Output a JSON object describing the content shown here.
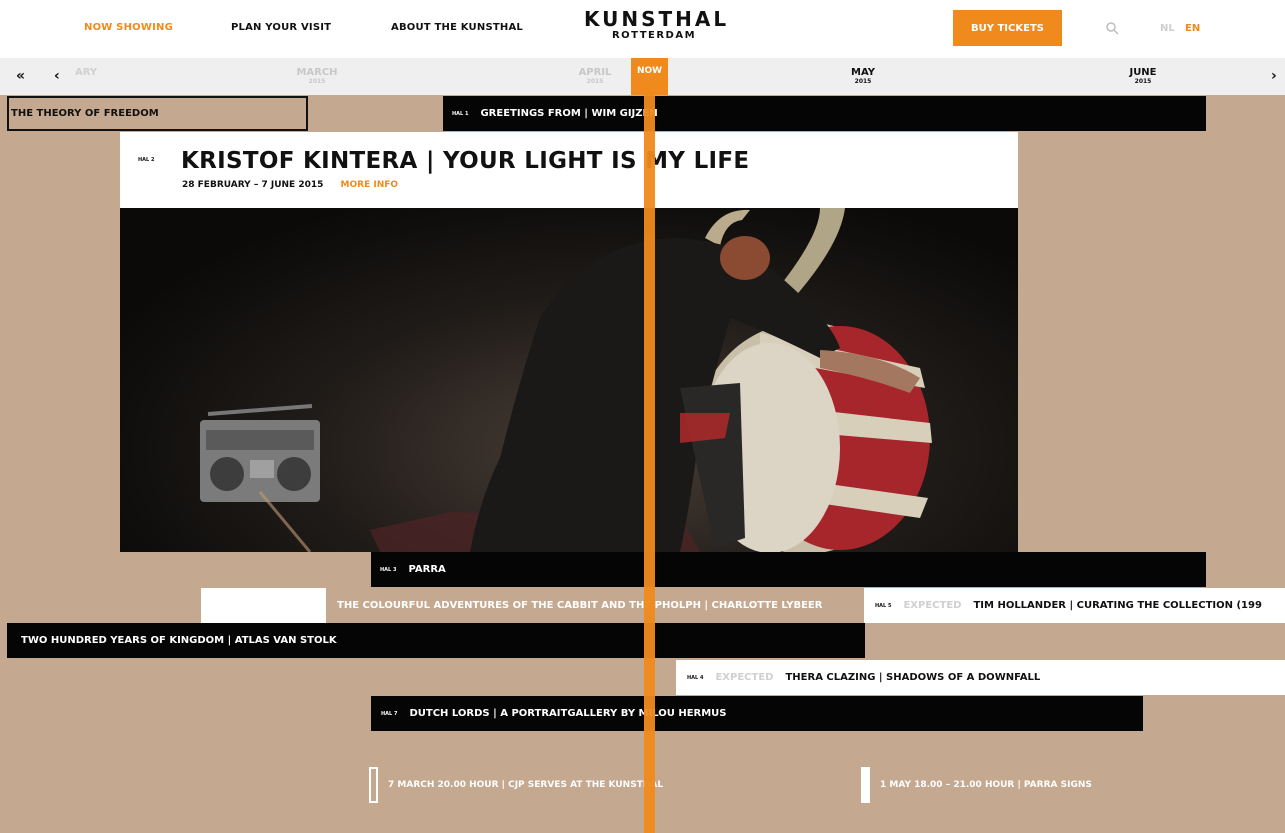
{
  "nav": {
    "now_showing": "NOW SHOWING",
    "plan_visit": "PLAN YOUR VISIT",
    "about": "ABOUT THE KUNSTHAL"
  },
  "logo": {
    "main": "KUNSTHAL",
    "sub": "ROTTERDAM"
  },
  "buy_tickets": "BUY TICKETS",
  "lang": {
    "nl": "NL",
    "en": "EN"
  },
  "timeline": {
    "partial_month": "ARY",
    "months": [
      {
        "name": "MARCH",
        "year": "2015"
      },
      {
        "name": "APRIL",
        "year": "2015"
      },
      {
        "name": "MAY",
        "year": "2015"
      },
      {
        "name": "JUNE",
        "year": "2015"
      }
    ],
    "now": "NOW"
  },
  "exhibitions": {
    "theory": {
      "title": "THE THEORY OF FREEDOM"
    },
    "greetings": {
      "hal": "HAL 1",
      "title": "GREETINGS FROM | WIM GIJZEN"
    },
    "parra": {
      "hal": "HAL 3",
      "title": "PARRA"
    },
    "cabbit": {
      "title": "THE COLOURFUL ADVENTURES OF THE CABBIT AND THE PHOLPH | CHARLOTTE LYBEER"
    },
    "tim": {
      "hal": "HAL 5",
      "expected": "EXPECTED",
      "title": "TIM HOLLANDER | CURATING THE COLLECTION (199"
    },
    "kingdom": {
      "title": "TWO HUNDRED YEARS OF KINGDOM | ATLAS VAN STOLK"
    },
    "thera": {
      "hal": "HAL 4",
      "expected": "EXPECTED",
      "title": "THERA CLAZING | SHADOWS OF A DOWNFALL"
    },
    "dutch": {
      "hal": "HAL 7",
      "title": "DUTCH LORDS | A PORTRAITGALLERY BY MILOU HERMUS"
    }
  },
  "feature": {
    "hal": "HAL 2",
    "title": "KRISTOF KINTERA | YOUR LIGHT IS MY LIFE",
    "dates": "28 FEBRUARY – 7 JUNE 2015",
    "more_info": "MORE INFO"
  },
  "events": [
    {
      "label": "7 MARCH 20.00 HOUR | CJP SERVES AT THE KUNSTHAL"
    },
    {
      "label": "1 MAY 18.00 – 21.00 HOUR | PARRA SIGNS"
    }
  ]
}
